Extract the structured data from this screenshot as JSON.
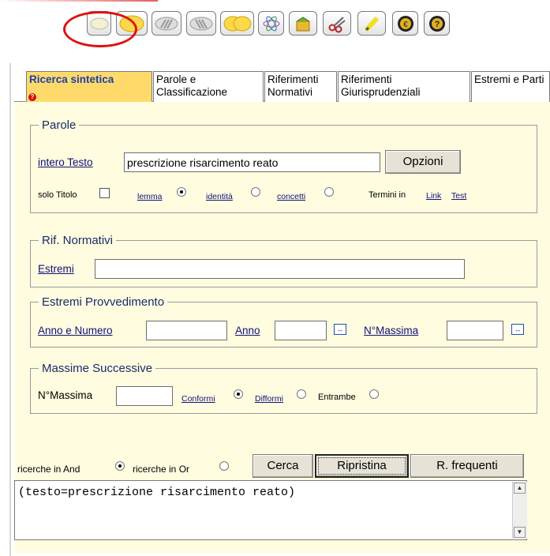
{
  "toolbar": {
    "icons": [
      "white-oval-icon",
      "yellow-oval-icon",
      "striped-oval-icon",
      "striped-oval-2-icon",
      "double-oval-icon",
      "atom-icon",
      "package-icon",
      "scissors-icon",
      "highlighter-icon",
      "euro-icon",
      "help-icon"
    ]
  },
  "tabs": [
    {
      "label": "Ricerca sintetica"
    },
    {
      "label": "Parole e Classificazione"
    },
    {
      "label": "Riferimenti Normativi"
    },
    {
      "label": "Riferimenti Giurisprudenziali"
    },
    {
      "label": "Estremi e Parti"
    }
  ],
  "parole": {
    "legend": "Parole",
    "intero_label": "intero Testo",
    "search_value": "prescrizione risarcimento reato",
    "opzioni": "Opzioni",
    "solo_titolo": "solo Titolo",
    "lemma": "lemma",
    "identita": "identità",
    "concetti": "concetti",
    "termini_in": "Termini in",
    "link": "Link",
    "test": "Test"
  },
  "rif": {
    "legend": "Rif. Normativi",
    "estremi": "Estremi",
    "estremi_value": ""
  },
  "estremi": {
    "legend": "Estremi Provvedimento",
    "anno_numero": "Anno e Numero",
    "anno": "Anno",
    "nmassima": "N°Massima"
  },
  "massime": {
    "legend": "Massime Successive",
    "nmassima": "N°Massima",
    "conformi": "Conformi",
    "difformi": "Difformi",
    "entrambe": "Entrambe"
  },
  "bottom": {
    "and_label": "ricerche in And",
    "or_label": "ricerche in Or",
    "cerca": "Cerca",
    "ripristina": "Ripristina",
    "frequenti": "R. frequenti",
    "query": "(testo=prescrizione risarcimento reato)"
  },
  "colors": {
    "accent": "#ffda6b",
    "panel": "#fffce0",
    "link": "#10107a",
    "mark": "#e01010"
  }
}
